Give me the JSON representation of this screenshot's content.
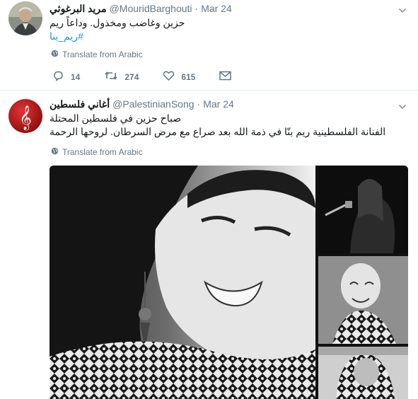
{
  "tweets": [
    {
      "display_name": "مريد البرغوثي",
      "handle": "@MouridBarghouti",
      "separator": "·",
      "date": "Mar 24",
      "text": "حزين وغاضب ومخذول. وداعاً ريم",
      "hashtag": "#ريم_بنا",
      "translate_label": "Translate from Arabic",
      "replies": "14",
      "retweets": "274",
      "likes": "615"
    },
    {
      "display_name": "أغاني فلسطين",
      "handle": "@PalestinianSong",
      "separator": "·",
      "date": "Mar 24",
      "line1": "صباح حزين في فلسطين المحتلة",
      "line2": "الفنانة الفلسطينية ريم بنّا في ذمة الله بعد صراع مع مرض السرطان. لروحها الرحمة",
      "translate_label": "Translate from Arabic"
    }
  ],
  "icons": {
    "caret": "chevron-down-icon",
    "globe": "globe-icon",
    "reply": "reply-icon",
    "retweet": "retweet-icon",
    "like": "heart-icon",
    "dm": "envelope-icon"
  },
  "colors": {
    "link": "#1b95e0",
    "secondary_text": "#657786",
    "divider": "#e6ecf0",
    "avatar2_bg": "#cc1a1a"
  }
}
